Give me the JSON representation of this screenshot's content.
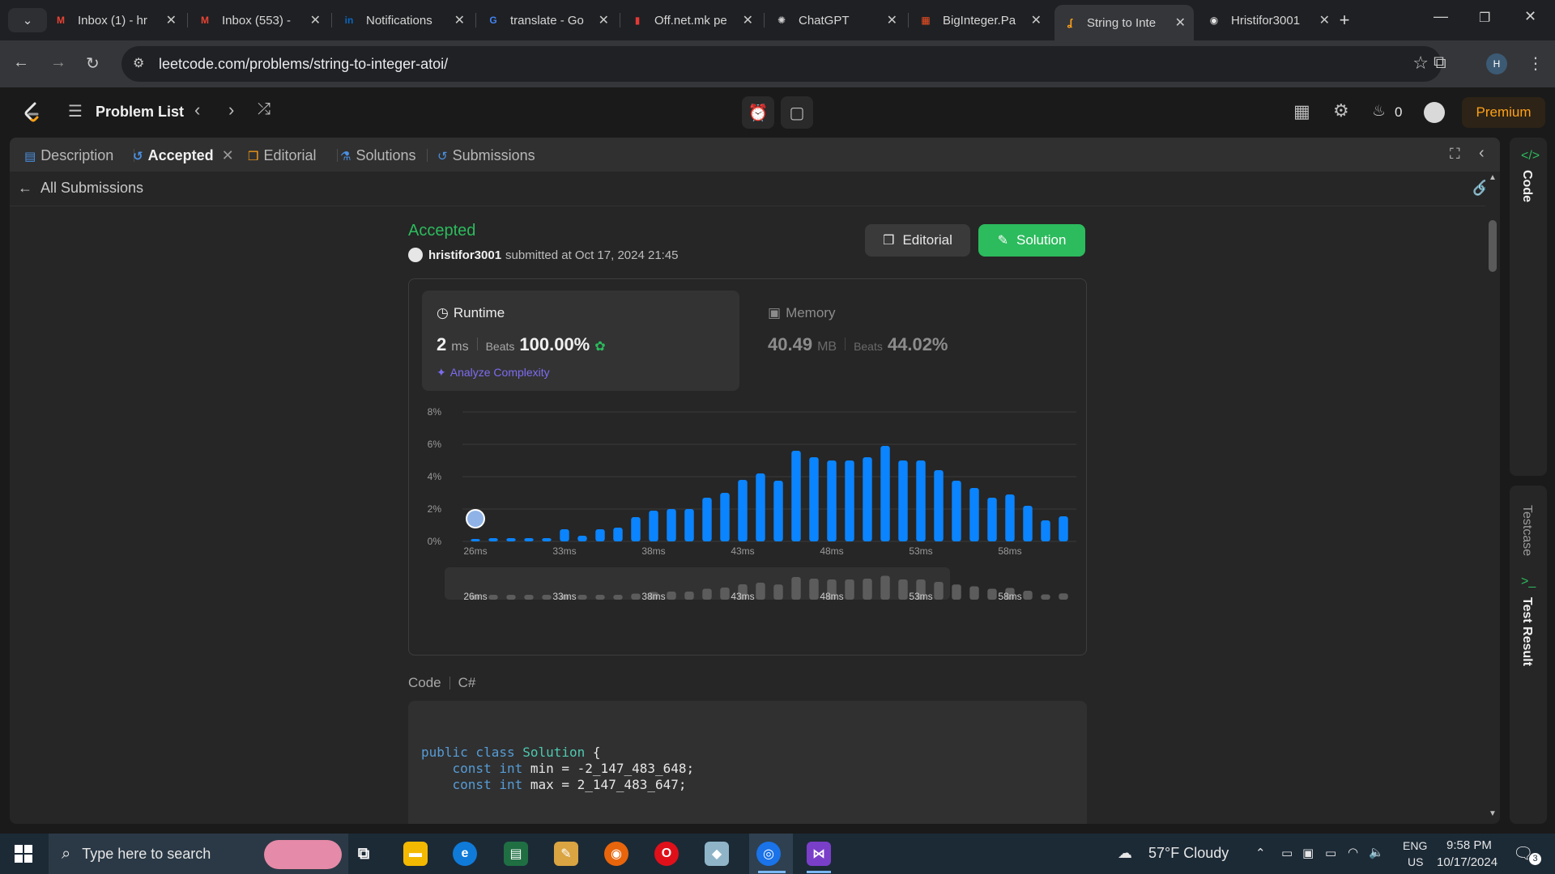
{
  "browser": {
    "tabs": [
      {
        "title": "Inbox (1) - hr",
        "icon": "gmail-icon",
        "color": "#ea4335",
        "glyph": "M"
      },
      {
        "title": "Inbox (553) -",
        "icon": "gmail-icon",
        "color": "#ea4335",
        "glyph": "M"
      },
      {
        "title": "Notifications",
        "icon": "linkedin-icon",
        "color": "#0a66c2",
        "glyph": "in"
      },
      {
        "title": "translate - Go",
        "icon": "google-icon",
        "color": "#4285f4",
        "glyph": "G"
      },
      {
        "title": "Off.net.mk pe",
        "icon": "pdf-icon",
        "color": "#e53935",
        "glyph": "▮"
      },
      {
        "title": "ChatGPT",
        "icon": "chatgpt-icon",
        "color": "#d0d0d0",
        "glyph": "✺"
      },
      {
        "title": "BigInteger.Pa",
        "icon": "microsoft-icon",
        "color": "#f25022",
        "glyph": "▦"
      },
      {
        "title": "String to Inte",
        "icon": "leetcode-icon",
        "color": "#ffa116",
        "glyph": "ʆ"
      },
      {
        "title": "Hristifor3001",
        "icon": "github-icon",
        "color": "#e6e6e6",
        "glyph": "◉"
      }
    ],
    "active_tab": 7,
    "url": "leetcode.com/problems/string-to-integer-atoi/",
    "profile_initial": "H"
  },
  "header": {
    "problem_list": "Problem List",
    "streak": "0",
    "premium": "Premium"
  },
  "panel": {
    "tabs": {
      "description": "Description",
      "accepted": "Accepted",
      "editorial": "Editorial",
      "solutions": "Solutions",
      "submissions": "Submissions"
    },
    "all_submissions": "All Submissions",
    "status": "Accepted",
    "username": "hristifor3001",
    "submitted_at": "submitted at Oct 17, 2024 21:45",
    "editorial_btn": "Editorial",
    "solution_btn": "Solution",
    "runtime": {
      "title": "Runtime",
      "value": "2",
      "unit": "ms",
      "beats_label": "Beats",
      "beats": "100.00%",
      "analyze": "Analyze Complexity"
    },
    "memory": {
      "title": "Memory",
      "value": "40.49",
      "unit": "MB",
      "beats_label": "Beats",
      "beats": "44.02%"
    },
    "code_label": "Code",
    "language": "C#",
    "code_lines": [
      {
        "kw1": "public class ",
        "ty": "Solution",
        "rest": " {"
      },
      {
        "kw1": "    const int ",
        "ty": "",
        "rest": "min = -2_147_483_648;"
      },
      {
        "kw1": "    const int ",
        "ty": "",
        "rest": "max = 2_147_483_647;"
      }
    ]
  },
  "rail": {
    "code": "Code",
    "testcase": "Testcase",
    "test_result": "Test Result"
  },
  "chart_data": {
    "type": "bar",
    "ylabel": "",
    "xlabel": "",
    "ylim": [
      0,
      8
    ],
    "y_ticks": [
      "0%",
      "2%",
      "4%",
      "6%",
      "8%"
    ],
    "x_ticks": [
      "26ms",
      "33ms",
      "38ms",
      "43ms",
      "48ms",
      "53ms",
      "58ms"
    ],
    "values": [
      0.15,
      0.2,
      0.2,
      0.2,
      0.2,
      0.75,
      0.35,
      0.75,
      0.85,
      1.5,
      1.9,
      2.0,
      2.0,
      2.7,
      3.0,
      3.8,
      4.2,
      3.75,
      5.6,
      5.2,
      5.0,
      5.0,
      5.2,
      5.9,
      5.0,
      5.0,
      4.4,
      3.75,
      3.3,
      2.7,
      2.9,
      2.2,
      1.3,
      1.55
    ],
    "your_submission_index": 0,
    "bar_color": "#0a84ff",
    "minimap_bar_color": "#5c5c5c"
  },
  "taskbar": {
    "search_placeholder": "Type here to search",
    "weather": "57°F  Cloudy",
    "lang1": "ENG",
    "lang2": "US",
    "time": "9:58 PM",
    "date": "10/17/2024",
    "notif_count": "3"
  }
}
